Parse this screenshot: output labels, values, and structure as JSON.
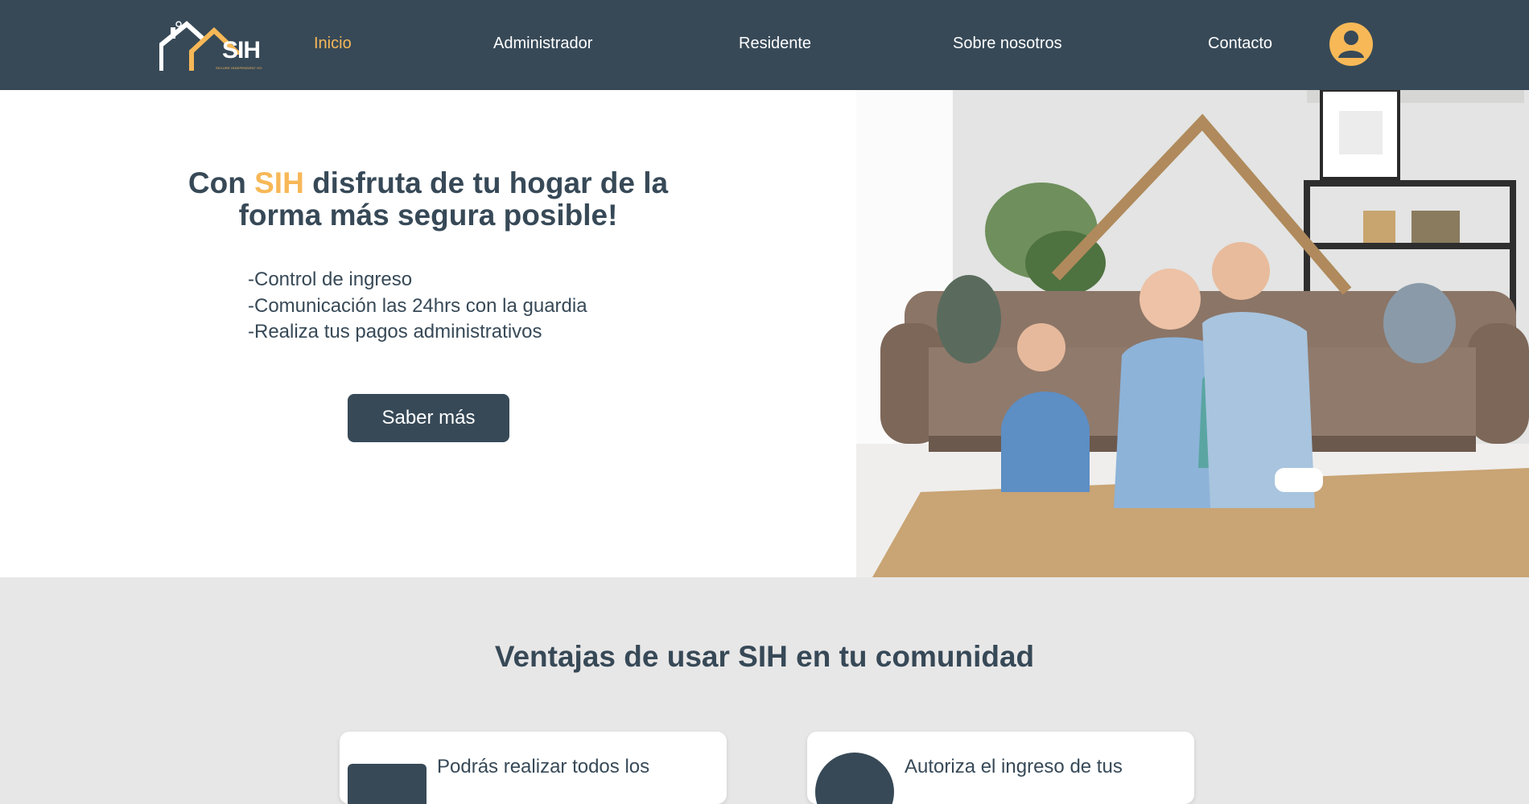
{
  "nav": {
    "logo_text": "SIH",
    "logo_subtitle": "SECURE INDEPENDENT HOME",
    "links": [
      "Inicio",
      "Administrador",
      "Residente",
      "Sobre nosotros",
      "Contacto"
    ],
    "active": "Inicio",
    "avatar_icon": "user-circle-icon"
  },
  "hero": {
    "title_pre": "Con ",
    "title_brand": "SIH",
    "title_post": " disfruta de tu hogar de la forma más segura posible!",
    "bullets": [
      "-Control de ingreso",
      "-Comunicación las 24hrs con la guardia",
      "-Realiza tus pagos administrativos"
    ],
    "button_label": "Saber más"
  },
  "advantages": {
    "title": "Ventajas de usar SIH en tu comunidad",
    "cards": [
      {
        "text": "Podrás realizar todos los"
      },
      {
        "text": "Autoriza el ingreso de tus"
      }
    ]
  },
  "colors": {
    "navy": "#374957",
    "accent": "#f7b857",
    "section_bg": "#e8e7e7"
  }
}
